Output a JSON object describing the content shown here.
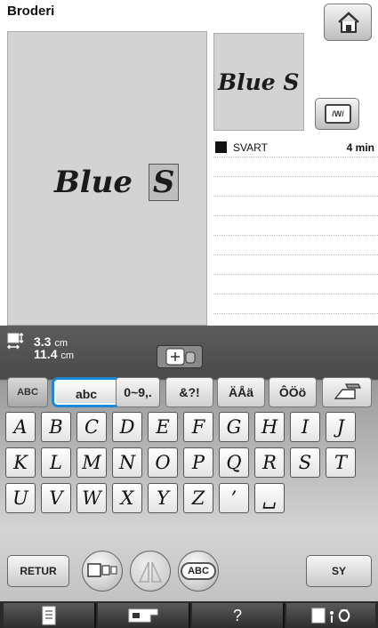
{
  "header": {
    "title": "Broderi",
    "home_icon": "home-icon"
  },
  "preview": {
    "text_main": "Blue",
    "text_cursor": "S",
    "small_text": "Blue S",
    "frame_icon": "embroidery-frame-icon"
  },
  "thread_list": {
    "rows": [
      {
        "color": "#111111",
        "name": "SVART",
        "time": "4 min"
      }
    ],
    "empty_rows": 8
  },
  "size": {
    "width": "3.3",
    "width_unit": "cm",
    "height": "11.4",
    "height_unit": "cm"
  },
  "tabs": [
    {
      "label": "ABC",
      "selected": false
    },
    {
      "label": "abc",
      "selected": true
    },
    {
      "label": "0~9,.",
      "selected": false
    },
    {
      "label": "&?!",
      "selected": false
    },
    {
      "label": "ÄÅä",
      "selected": false
    },
    {
      "label": "ÔÖö",
      "selected": false
    }
  ],
  "eraser_icon": "eraser-icon",
  "keys": [
    [
      "A",
      "B",
      "C",
      "D",
      "E",
      "F",
      "G",
      "H",
      "I",
      "J"
    ],
    [
      "K",
      "L",
      "M",
      "N",
      "O",
      "P",
      "Q",
      "R",
      "S",
      "T"
    ],
    [
      "U",
      "V",
      "W",
      "X",
      "Y",
      "Z",
      "’",
      "␣"
    ]
  ],
  "buttons": {
    "return_label": "RETUR",
    "array_icon": "array-icon",
    "mirror_icon": "mirror-icon",
    "abc_label": "ABC",
    "set_label": "SY"
  },
  "footer": {
    "items": [
      "document-icon",
      "sewing-machine-icon",
      "?",
      "settings-icon"
    ]
  },
  "colors": {
    "accent": "#1e88d6",
    "panel": "#4a4a4a"
  }
}
